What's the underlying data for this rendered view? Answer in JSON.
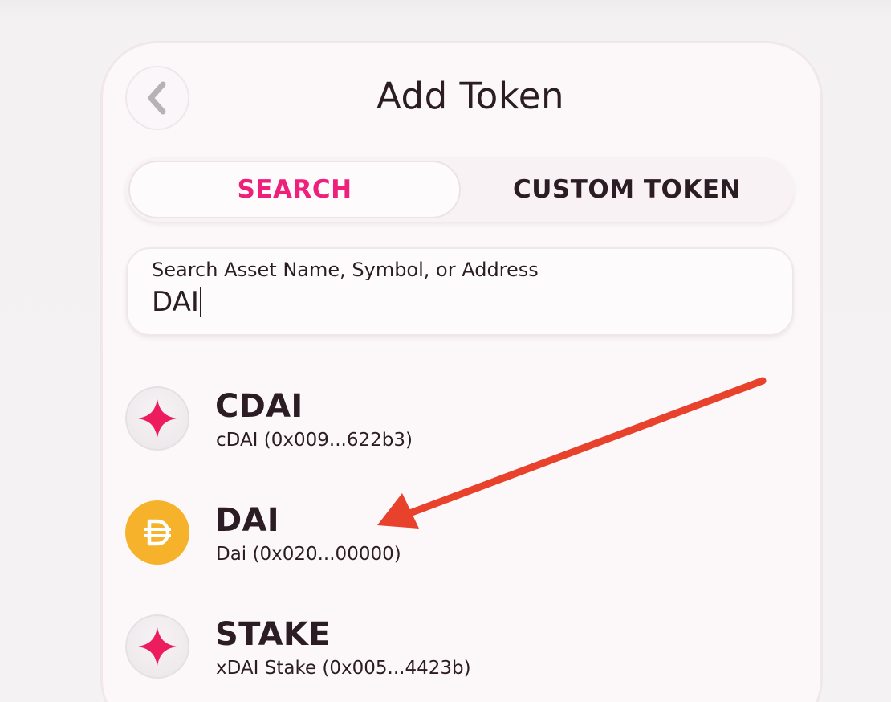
{
  "header": {
    "title": "Add Token",
    "back_icon": "chevron-left-icon"
  },
  "tabs": [
    {
      "label": "SEARCH",
      "active": true
    },
    {
      "label": "CUSTOM TOKEN",
      "active": false
    }
  ],
  "search": {
    "label": "Search Asset Name, Symbol, or Address",
    "value": "DAI"
  },
  "tokens": [
    {
      "symbol": "CDAI",
      "description": "cDAI (0x009...622b3)",
      "icon": "star-icon"
    },
    {
      "symbol": "DAI",
      "description": "Dai (0x020...00000)",
      "icon": "dai-icon"
    },
    {
      "symbol": "STAKE",
      "description": "xDAI Stake (0x005...4423b)",
      "icon": "star-icon"
    }
  ],
  "colors": {
    "accent": "#ef1f7c",
    "text": "#2b1d23",
    "dai": "#f6b22a",
    "annotation_arrow": "#e8412c"
  },
  "annotation": {
    "type": "arrow",
    "points_to": "DAI"
  }
}
